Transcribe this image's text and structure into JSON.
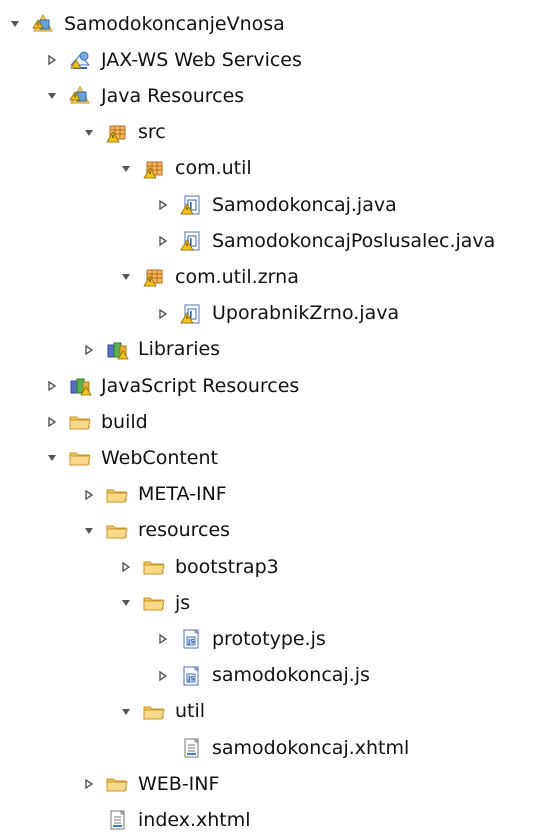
{
  "tree": {
    "items": [
      {
        "label": "SamodokoncanjeVnosa",
        "level": 0,
        "toggle": "expanded",
        "icon": "web-project-icon"
      },
      {
        "label": "JAX-WS Web Services",
        "level": 1,
        "toggle": "collapsed",
        "icon": "web-services-icon"
      },
      {
        "label": "Java Resources",
        "level": 1,
        "toggle": "expanded",
        "icon": "java-resources-icon"
      },
      {
        "label": "src",
        "level": 2,
        "toggle": "expanded",
        "icon": "source-folder-icon"
      },
      {
        "label": "com.util",
        "level": 3,
        "toggle": "expanded",
        "icon": "package-icon"
      },
      {
        "label": "Samodokoncaj.java",
        "level": 4,
        "toggle": "collapsed",
        "icon": "java-file-icon"
      },
      {
        "label": "SamodokoncajPoslusalec.java",
        "level": 4,
        "toggle": "collapsed",
        "icon": "java-file-icon"
      },
      {
        "label": "com.util.zrna",
        "level": 3,
        "toggle": "expanded",
        "icon": "package-icon"
      },
      {
        "label": "UporabnikZrno.java",
        "level": 4,
        "toggle": "collapsed",
        "icon": "java-file-icon"
      },
      {
        "label": "Libraries",
        "level": 2,
        "toggle": "collapsed",
        "icon": "libraries-icon"
      },
      {
        "label": "JavaScript Resources",
        "level": 1,
        "toggle": "collapsed",
        "icon": "libraries-icon"
      },
      {
        "label": "build",
        "level": 1,
        "toggle": "collapsed",
        "icon": "folder-icon"
      },
      {
        "label": "WebContent",
        "level": 1,
        "toggle": "expanded",
        "icon": "folder-icon"
      },
      {
        "label": "META-INF",
        "level": 2,
        "toggle": "collapsed",
        "icon": "folder-icon"
      },
      {
        "label": "resources",
        "level": 2,
        "toggle": "expanded",
        "icon": "folder-icon"
      },
      {
        "label": "bootstrap3",
        "level": 3,
        "toggle": "collapsed",
        "icon": "folder-icon"
      },
      {
        "label": "js",
        "level": 3,
        "toggle": "expanded",
        "icon": "folder-icon"
      },
      {
        "label": "prototype.js",
        "level": 4,
        "toggle": "collapsed",
        "icon": "js-file-icon"
      },
      {
        "label": "samodokoncaj.js",
        "level": 4,
        "toggle": "collapsed",
        "icon": "js-file-icon"
      },
      {
        "label": "util",
        "level": 3,
        "toggle": "expanded",
        "icon": "folder-icon"
      },
      {
        "label": "samodokoncaj.xhtml",
        "level": 4,
        "toggle": "none",
        "icon": "xhtml-file-icon"
      },
      {
        "label": "WEB-INF",
        "level": 2,
        "toggle": "collapsed",
        "icon": "folder-icon"
      },
      {
        "label": "index.xhtml",
        "level": 2,
        "toggle": "none",
        "icon": "xhtml-file-icon"
      }
    ]
  },
  "colors": {
    "text": "#111111",
    "toggle": "#555555",
    "folder": "#f2c45a",
    "folder_edge": "#c8962b",
    "package": "#d58a2d",
    "java": "#2c62b6",
    "warning": "#f4c21b"
  }
}
